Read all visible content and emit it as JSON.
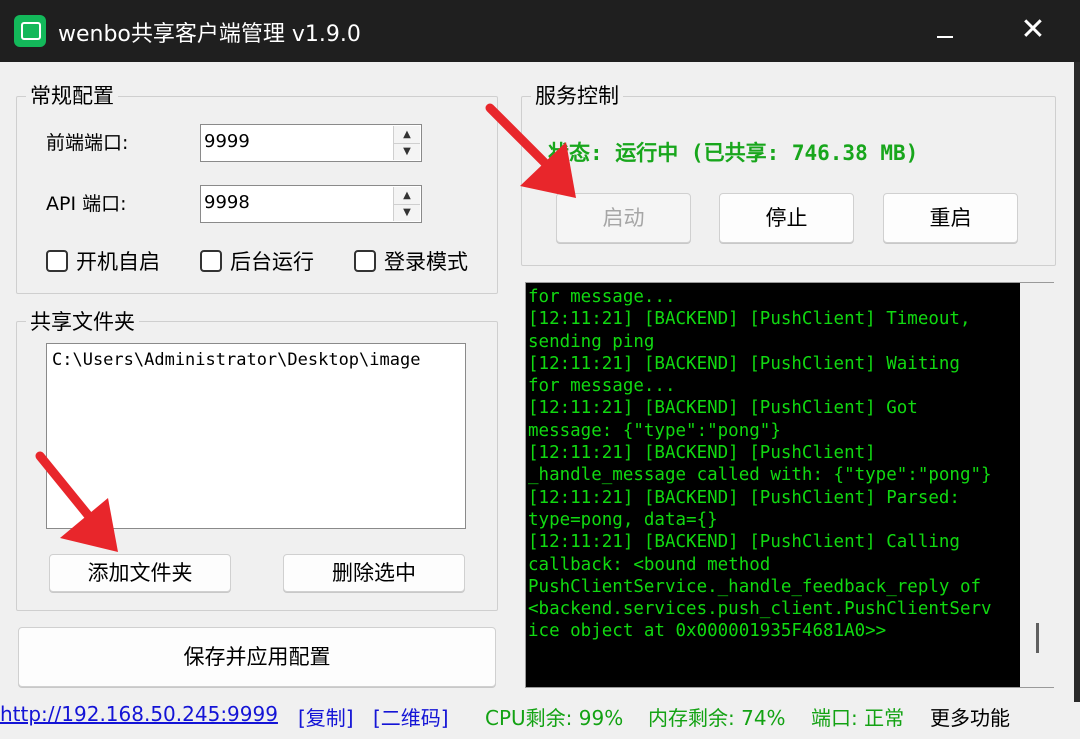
{
  "window": {
    "title": "wenbo共享客户端管理 v1.9.0",
    "min_icon": "minimize-icon",
    "close_glyph": "✕"
  },
  "general": {
    "title": "常规配置",
    "frontend_port_label": "前端端口:",
    "frontend_port_value": "9999",
    "api_port_label": "API 端口:",
    "api_port_value": "9998",
    "checkboxes": [
      {
        "label": "开机自启",
        "checked": false
      },
      {
        "label": "后台运行",
        "checked": false
      },
      {
        "label": "登录模式",
        "checked": false
      }
    ]
  },
  "shared": {
    "title": "共享文件夹",
    "items": [
      "C:\\Users\\Administrator\\Desktop\\image"
    ],
    "add_button": "添加文件夹",
    "delete_button": "删除选中"
  },
  "save_button": "保存并应用配置",
  "service": {
    "title": "服务控制",
    "status": "状态: 运行中 (已共享: 746.38 MB)",
    "start_button": "启动",
    "stop_button": "停止",
    "restart_button": "重启"
  },
  "console_lines": [
    "for message...",
    "[12:11:21] [BACKEND] [PushClient] Timeout,",
    "sending ping",
    "[12:11:21] [BACKEND] [PushClient] Waiting",
    "for message...",
    "[12:11:21] [BACKEND] [PushClient] Got",
    "message: {\"type\":\"pong\"}",
    "[12:11:21] [BACKEND] [PushClient]",
    "_handle_message called with: {\"type\":\"pong\"}",
    "[12:11:21] [BACKEND] [PushClient] Parsed:",
    "type=pong, data={}",
    "[12:11:21] [BACKEND] [PushClient] Calling",
    "callback: <bound method",
    "PushClientService._handle_feedback_reply of",
    "<backend.services.push_client.PushClientServ",
    "ice object at 0x000001935F4681A0>>"
  ],
  "statusbar": {
    "url": "http://192.168.50.245:9999",
    "copy": "[复制]",
    "qr": "[二维码]",
    "cpu": "CPU剩余: 99%",
    "mem": "内存剩余: 74%",
    "port": "端口: 正常",
    "more": "更多功能"
  },
  "colors": {
    "console_bg": "#000000",
    "console_text": "#11d911",
    "status_green": "#18a61c",
    "link_blue": "#1414d6",
    "arrow_red": "#e8262b"
  }
}
